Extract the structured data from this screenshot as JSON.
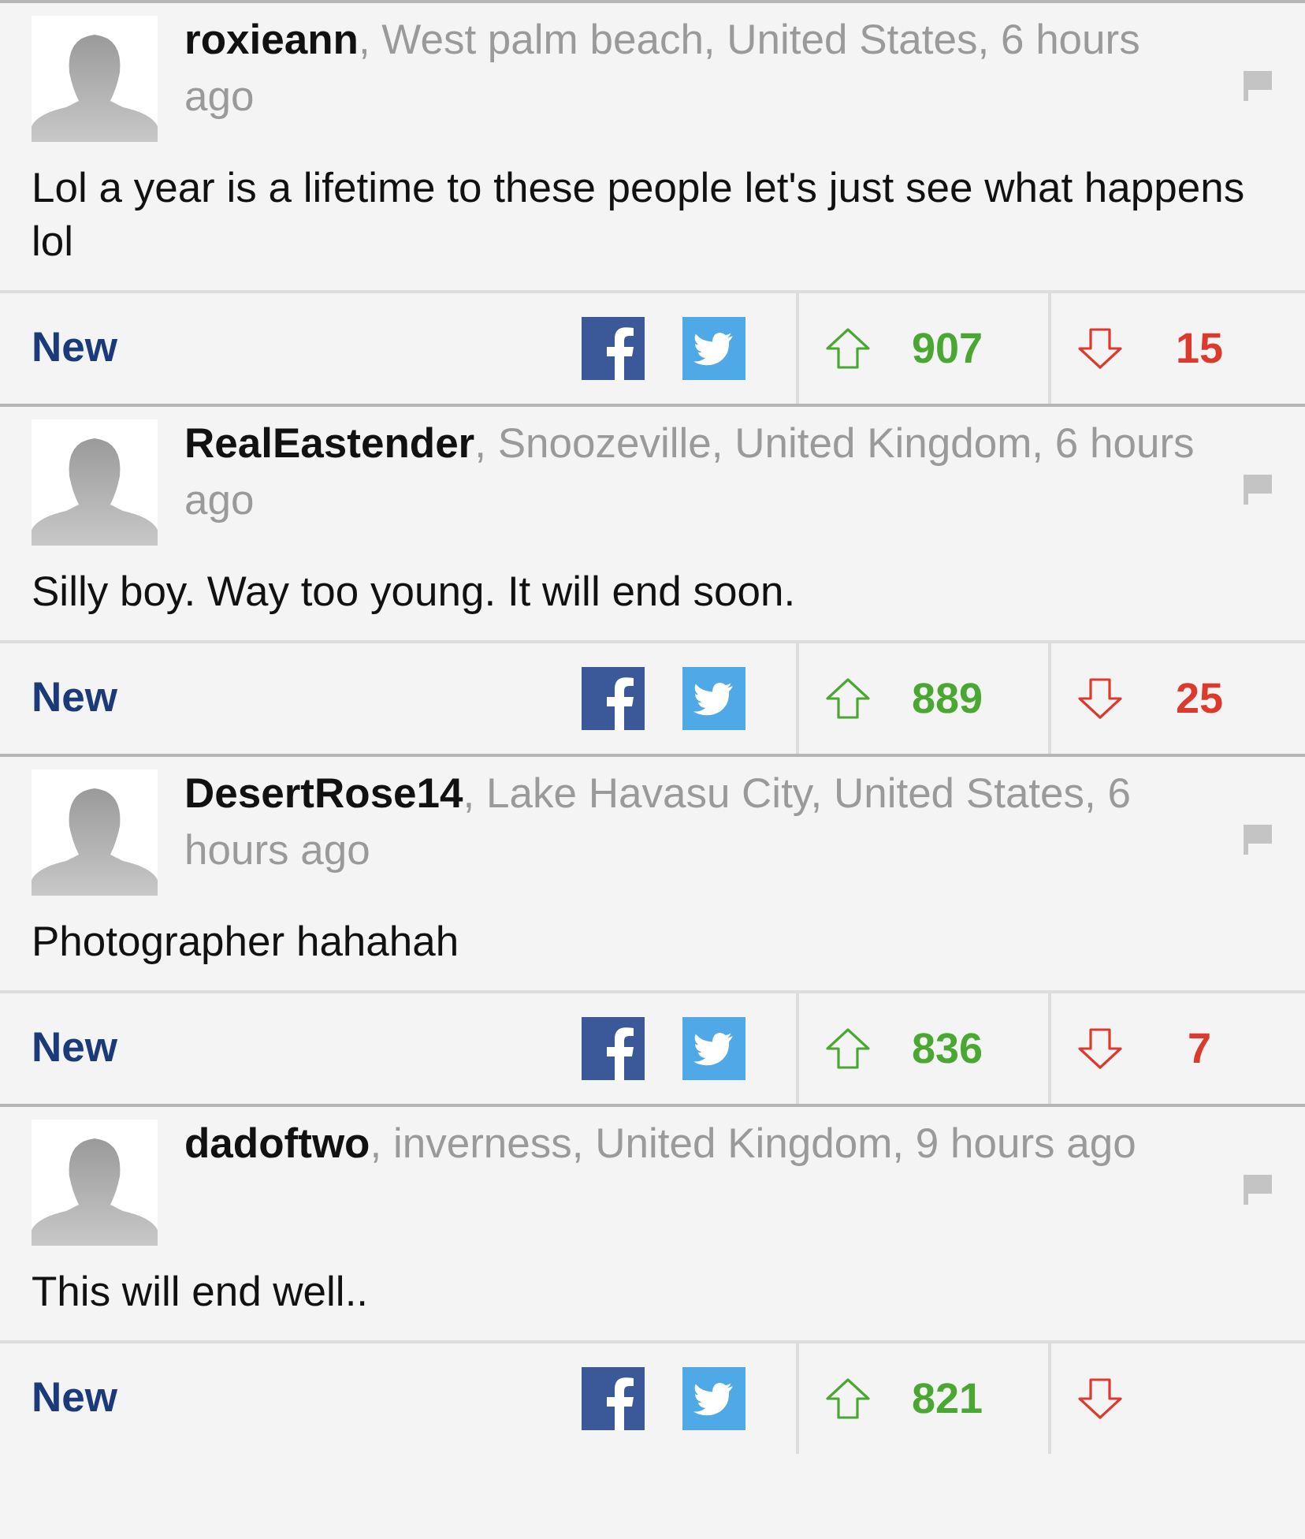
{
  "comments": [
    {
      "username": "roxieann",
      "meta": ", West palm beach, United States, 6 hours ago",
      "text": "Lol a year is a lifetime to these people let's just see what happens lol",
      "tag": "New",
      "upvotes": "907",
      "downvotes": "15"
    },
    {
      "username": "RealEastender",
      "meta": ", Snoozeville, United Kingdom, 6 hours ago",
      "text": "Silly boy. Way too young. It will end soon.",
      "tag": "New",
      "upvotes": "889",
      "downvotes": "25"
    },
    {
      "username": "DesertRose14",
      "meta": ", Lake Havasu City, United States, 6 hours ago",
      "text": "Photographer hahahah",
      "tag": "New",
      "upvotes": "836",
      "downvotes": "7"
    },
    {
      "username": "dadoftwo",
      "meta": ", inverness, United Kingdom, 9 hours ago",
      "text": "This will end well..",
      "tag": "New",
      "upvotes": "821"
    }
  ]
}
